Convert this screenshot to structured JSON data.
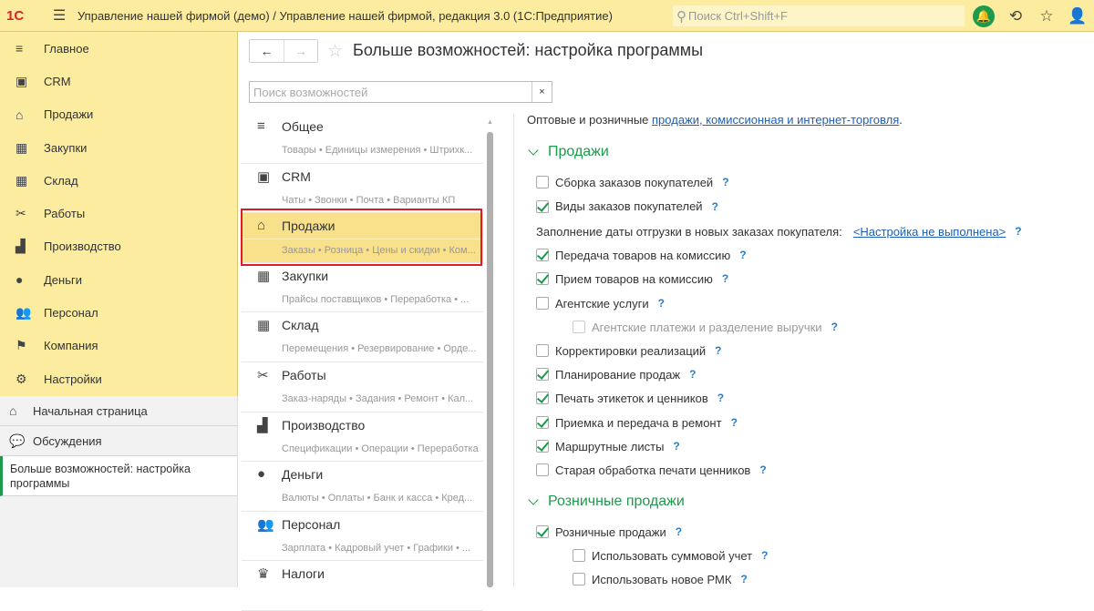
{
  "topbar": {
    "logo": "1С",
    "title": "Управление нашей фирмой (демо) / Управление нашей фирмой, редакция 3.0  (1С:Предприятие)",
    "search_placeholder": "Поиск Ctrl+Shift+F"
  },
  "sidebar": {
    "items": [
      {
        "label": "Главное",
        "icon": "≡"
      },
      {
        "label": "CRM",
        "icon": "▣"
      },
      {
        "label": "Продажи",
        "icon": "⌂"
      },
      {
        "label": "Закупки",
        "icon": "▦"
      },
      {
        "label": "Склад",
        "icon": "▦"
      },
      {
        "label": "Работы",
        "icon": "✂"
      },
      {
        "label": "Производство",
        "icon": "▟"
      },
      {
        "label": "Деньги",
        "icon": "●"
      },
      {
        "label": "Персонал",
        "icon": "👥"
      },
      {
        "label": "Компания",
        "icon": "⚑"
      },
      {
        "label": "Настройки",
        "icon": "⚙"
      }
    ]
  },
  "lower": {
    "home": "Начальная страница",
    "discussions": "Обсуждения",
    "active_tab": "Больше возможностей: настройка программы"
  },
  "page": {
    "title": "Больше возможностей: настройка программы",
    "search_placeholder": "Поиск возможностей",
    "clear": "×"
  },
  "categories": [
    {
      "name": "Общее",
      "sub": "Товары • Единицы измерения • Штрихк...",
      "icon": "≡"
    },
    {
      "name": "CRM",
      "sub": "Чаты • Звонки • Почта • Варианты КП",
      "icon": "▣"
    },
    {
      "name": "Продажи",
      "sub": "Заказы • Розница • Цены и скидки • Ком...",
      "icon": "⌂"
    },
    {
      "name": "Закупки",
      "sub": "Прайсы поставщиков • Переработка • ...",
      "icon": "▦"
    },
    {
      "name": "Склад",
      "sub": "Перемещения • Резервирование • Орде...",
      "icon": "▦"
    },
    {
      "name": "Работы",
      "sub": "Заказ-наряды • Задания • Ремонт • Кал...",
      "icon": "✂"
    },
    {
      "name": "Производство",
      "sub": "Спецификации • Операции • Переработка",
      "icon": "▟"
    },
    {
      "name": "Деньги",
      "sub": "Валюты • Оплаты • Банк и касса • Кред...",
      "icon": "●"
    },
    {
      "name": "Персонал",
      "sub": "Зарплата • Кадровый учет • Графики • ...",
      "icon": "👥"
    },
    {
      "name": "Налоги",
      "sub": "",
      "icon": "♛"
    }
  ],
  "right": {
    "intro": "Оптовые и розничные ",
    "intro_link": "продажи, комиссионная и интернет-торговля",
    "intro_end": ".",
    "section1": "Продажи",
    "options1": [
      {
        "label": "Сборка заказов покупателей",
        "checked": false
      },
      {
        "label": "Виды заказов покупателей",
        "checked": true
      }
    ],
    "ship_date_label": "Заполнение даты отгрузки в новых заказах покупателя:",
    "ship_date_link": "<Настройка не выполнена>",
    "options2": [
      {
        "label": "Передача товаров на комиссию",
        "checked": true
      },
      {
        "label": "Прием товаров на комиссию",
        "checked": true
      },
      {
        "label": "Агентские услуги",
        "checked": false
      },
      {
        "label": "Агентские платежи и разделение выручки",
        "checked": false,
        "disabled": true
      },
      {
        "label": "Корректировки реализаций",
        "checked": false
      },
      {
        "label": "Планирование продаж",
        "checked": true
      },
      {
        "label": "Печать этикеток и ценников",
        "checked": true
      },
      {
        "label": "Приемка и передача в ремонт",
        "checked": true
      },
      {
        "label": "Маршрутные листы",
        "checked": true
      },
      {
        "label": "Старая обработка печати ценников",
        "checked": false
      }
    ],
    "section2": "Розничные продажи",
    "options3": [
      {
        "label": "Розничные продажи",
        "checked": true
      },
      {
        "label": "Использовать суммовой учет",
        "checked": false
      },
      {
        "label": "Использовать новое РМК",
        "checked": false
      }
    ],
    "help": "?"
  }
}
